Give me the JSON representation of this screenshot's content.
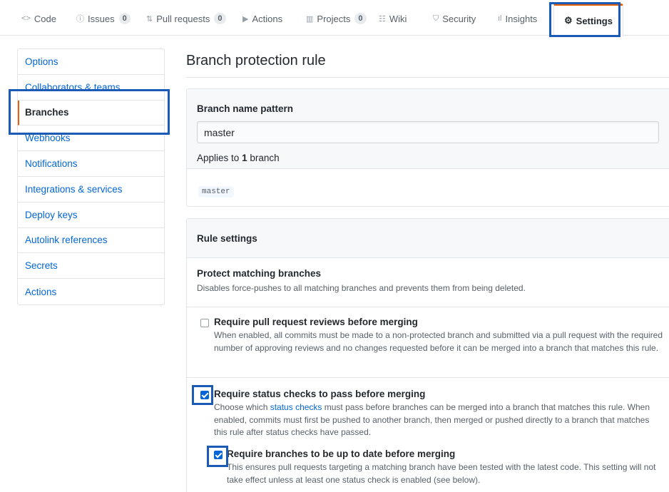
{
  "reponav": {
    "tabs": [
      {
        "label": "Code",
        "icon": "code-icon",
        "glyph": "<>"
      },
      {
        "label": "Issues",
        "icon": "issue-icon",
        "glyph": "ⓘ",
        "count": "0"
      },
      {
        "label": "Pull requests",
        "icon": "pull-request-icon",
        "glyph": "⇅",
        "count": "0"
      },
      {
        "label": "Actions",
        "icon": "play-icon",
        "glyph": "▶"
      },
      {
        "label": "Projects",
        "icon": "project-icon",
        "glyph": "▥",
        "count": "0"
      },
      {
        "label": "Wiki",
        "icon": "book-icon",
        "glyph": "☷"
      },
      {
        "label": "Security",
        "icon": "shield-icon",
        "glyph": "⛉"
      },
      {
        "label": "Insights",
        "icon": "graph-icon",
        "glyph": "ıl"
      },
      {
        "label": "Settings",
        "icon": "gear-icon",
        "glyph": "⚙"
      }
    ]
  },
  "sidebar": {
    "items": [
      {
        "label": "Options"
      },
      {
        "label": "Collaborators & teams"
      },
      {
        "label": "Branches"
      },
      {
        "label": "Webhooks"
      },
      {
        "label": "Notifications"
      },
      {
        "label": "Integrations & services"
      },
      {
        "label": "Deploy keys"
      },
      {
        "label": "Autolink references"
      },
      {
        "label": "Secrets"
      },
      {
        "label": "Actions"
      }
    ],
    "active": "Branches"
  },
  "main": {
    "title": "Branch protection rule",
    "pattern_label": "Branch name pattern",
    "pattern_value": "master",
    "applies_prefix": "Applies to",
    "applies_count": "1",
    "applies_suffix": "branch",
    "matched_branch": "master",
    "rule_settings_label": "Rule settings",
    "protect_title": "Protect matching branches",
    "protect_desc": "Disables force-pushes to all matching branches and prevents them from being deleted.",
    "options": {
      "pr_reviews": {
        "title": "Require pull request reviews before merging",
        "desc": "When enabled, all commits must be made to a non-protected branch and submitted via a pull request with the required number of approving reviews and no changes requested before it can be merged into a branch that matches this rule.",
        "checked": false
      },
      "status_checks": {
        "title": "Require status checks to pass before merging",
        "desc_before": "Choose which ",
        "desc_link": "status checks",
        "desc_after": " must pass before branches can be merged into a branch that matches this rule. When enabled, commits must first be pushed to another branch, then merged or pushed directly to a branch that matches this rule after status checks have passed.",
        "checked": true
      },
      "up_to_date": {
        "title": "Require branches to be up to date before merging",
        "desc": "This ensures pull requests targeting a matching branch have been tested with the latest code. This setting will not take effect unless at least one status check is enabled (see below).",
        "checked": true
      }
    }
  },
  "colors": {
    "link": "#0366d6",
    "active_accent": "#e36209",
    "annotation": "#1b5bb5",
    "checkbox_checked": "#0366d6"
  }
}
